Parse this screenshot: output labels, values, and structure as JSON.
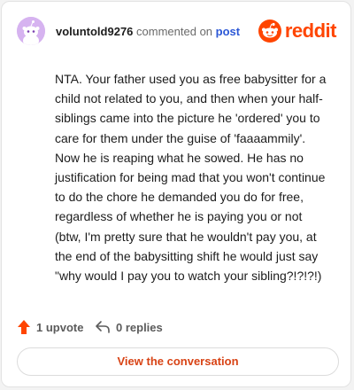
{
  "comment": {
    "username": "voluntold9276",
    "action_text": "commented on",
    "post_link": "post",
    "body": "NTA. Your father used you as free babysitter for a child not related to you, and then when your half-siblings came into the picture he 'ordered' you to care for them under the guise of 'faaaammily'. Now he is reaping what he sowed. He has no justification for being mad that you won't continue to do the chore he demanded you do for free, regardless of whether he is paying you or not (btw, I'm pretty sure that he wouldn't pay you, at the end of the babysitting shift he would just say \"why would I pay you to watch your sibling?!?!?!)"
  },
  "brand": {
    "wordmark": "reddit",
    "color": "#ff4500"
  },
  "actions": {
    "upvotes": "1 upvote",
    "replies": "0 replies"
  },
  "footer": {
    "view_button": "View the conversation"
  },
  "colors": {
    "accent": "#ff4500",
    "link": "#2c58d6",
    "button_text": "#d84315",
    "avatar_bg": "#d6b3f0"
  },
  "icons": [
    "snoo-avatar-icon",
    "reddit-logo-icon",
    "upvote-arrow-icon",
    "reply-arrow-icon"
  ]
}
